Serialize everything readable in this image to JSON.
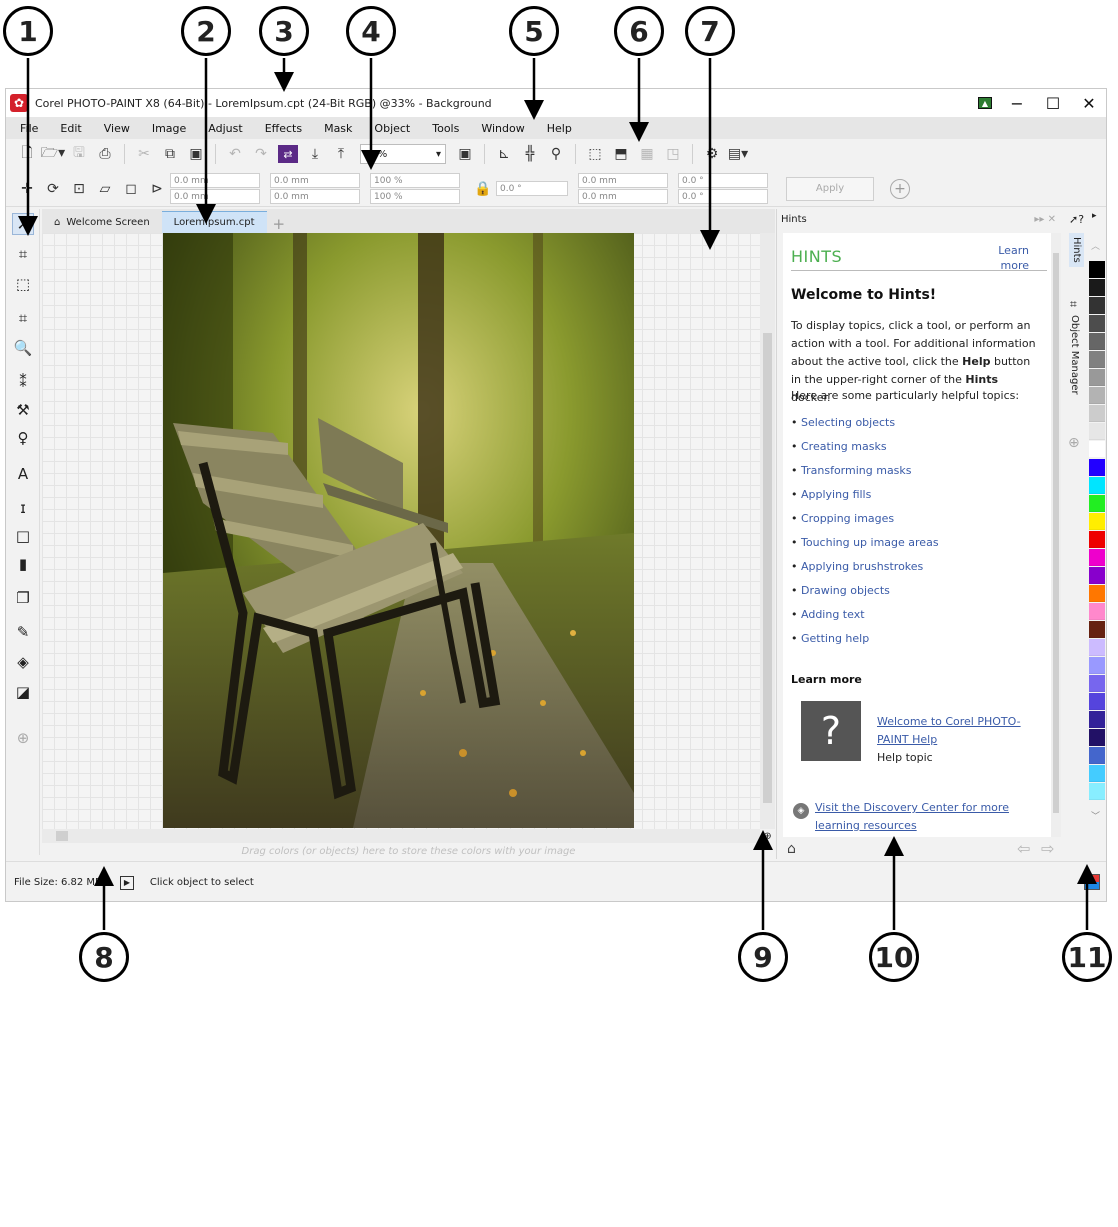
{
  "callouts": [
    "1",
    "2",
    "3",
    "4",
    "5",
    "6",
    "7",
    "8",
    "9",
    "10",
    "11"
  ],
  "window": {
    "title": "Corel PHOTO-PAINT X8 (64-Bit) - LoremIpsum.cpt (24-Bit RGB) @33% - Background",
    "controls": {
      "minimize": "−",
      "maximize": "☐",
      "close": "✕"
    }
  },
  "menu": [
    "File",
    "Edit",
    "View",
    "Image",
    "Adjust",
    "Effects",
    "Mask",
    "Object",
    "Tools",
    "Window",
    "Help"
  ],
  "toolbar": {
    "zoom_value": "33%"
  },
  "property_bar": {
    "x": "0.0 mm",
    "y": "0.0 mm",
    "w": "0.0 mm",
    "h": "0.0 mm",
    "scale_w": "100 %",
    "scale_h": "100 %",
    "angle": "0.0 °",
    "skew_x": "0.0 mm",
    "skew_y": "0.0 mm",
    "rot_x": "0.0 °",
    "rot_y": "0.0 °",
    "apply_label": "Apply"
  },
  "tabs": [
    {
      "label": "Welcome Screen",
      "icon": "home-icon"
    },
    {
      "label": "LoremIpsum.cpt",
      "active": true
    }
  ],
  "doc_palette_hint": "Drag colors (or objects) here to store these colors with your image",
  "hints": {
    "docker_title": "Hints",
    "heading": "HINTS",
    "learn_more_link": "Learn more",
    "welcome": "Welcome to Hints!",
    "intro_parts": [
      "To display topics, click a tool, or perform an action with a tool. For additional information about the active tool, click the ",
      "Help",
      " button in the upper-right corner of the ",
      "Hints",
      " docker."
    ],
    "helpful": "Here are some particularly helpful topics:",
    "topics": [
      "Selecting objects",
      "Creating masks",
      "Transforming masks",
      "Applying fills",
      "Cropping images",
      "Touching up image areas",
      "Applying brushstrokes",
      "Drawing objects",
      "Adding text",
      "Getting help"
    ],
    "learn_more_heading": "Learn more",
    "help_link": "Welcome to Corel PHOTO-PAINT Help",
    "help_topic": "Help topic",
    "discovery_link": "Visit the Discovery Center for more learning resources"
  },
  "vertical_tabs": [
    "Hints",
    "Object Manager"
  ],
  "palette_colors": [
    "#000000",
    "#1a1a1a",
    "#333333",
    "#4d4d4d",
    "#666666",
    "#808080",
    "#999999",
    "#b3b3b3",
    "#cccccc",
    "#e6e6e6",
    "#ffffff",
    "#2200ff",
    "#00e5ff",
    "#22ee22",
    "#ffee00",
    "#ee0000",
    "#ee00cc",
    "#8800cc",
    "#ff7700",
    "#ff88cc",
    "#662211",
    "#ccbbff",
    "#9999ff",
    "#7766ee",
    "#5544dd",
    "#332299",
    "#221166",
    "#4466cc",
    "#44ccff",
    "#88eeff"
  ],
  "status": {
    "file_size": "File Size: 6.82 MB",
    "message": "Click object to select"
  }
}
